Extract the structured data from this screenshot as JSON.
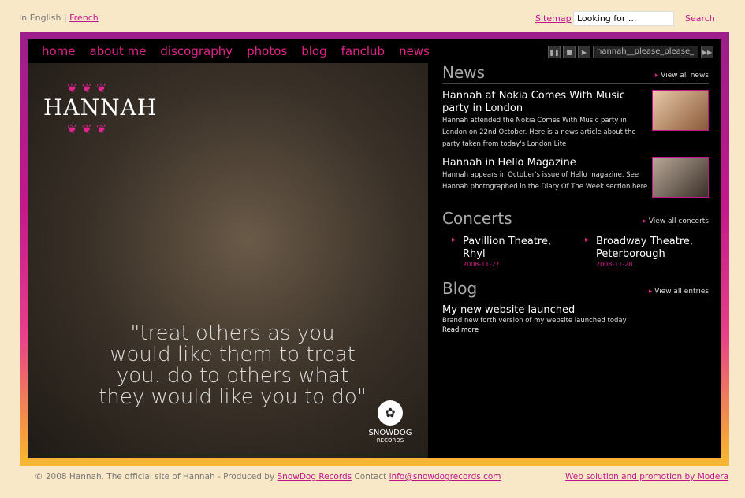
{
  "top": {
    "lang_current": "In English",
    "lang_sep": " | ",
    "lang_alt": "French",
    "sitemap": "Sitemap",
    "search_value": "Looking for ...",
    "search_button": "Search"
  },
  "nav": [
    "home",
    "about me",
    "discography",
    "photos",
    "blog",
    "fanclub",
    "news"
  ],
  "player": {
    "track": "hannah__please_please_"
  },
  "hero": {
    "logo": "HANNAH",
    "quote": "\"treat others as you would like them to treat you. do to others what they would like you to do\"",
    "label_name": "SNOWDOG",
    "label_sub": "RECORDS"
  },
  "news": {
    "title": "News",
    "link": "View all news",
    "items": [
      {
        "title": "Hannah at Nokia Comes With Music party in London",
        "desc": "Hannah attended the Nokia Comes With Music party in London on 22nd October. Here is a news article about the party taken from today's London Lite"
      },
      {
        "title": "Hannah in Hello Magazine",
        "desc": "Hannah appears in October's issue of Hello magazine. See Hannah photographed in the Diary Of The Week section here."
      }
    ]
  },
  "concerts": {
    "title": "Concerts",
    "link": "View all concerts",
    "items": [
      {
        "name": "Pavillion Theatre, Rhyl",
        "date": "2008-11-27"
      },
      {
        "name": "Broadway Theatre, Peterborough",
        "date": "2008-11-28"
      }
    ]
  },
  "blog": {
    "title": "Blog",
    "link": "View all entries",
    "entry_title": "My new website launched",
    "entry_desc": "Brand new forth version of my website launched today",
    "more": "Read more"
  },
  "footer": {
    "text1": "© 2008 Hannah. The official site of Hannah - Produced by ",
    "link1": "SnowDog Records",
    "text2": " Contact ",
    "link2": "info@snowdogrecords.com",
    "right": "Web solution and promotion by Modera"
  }
}
